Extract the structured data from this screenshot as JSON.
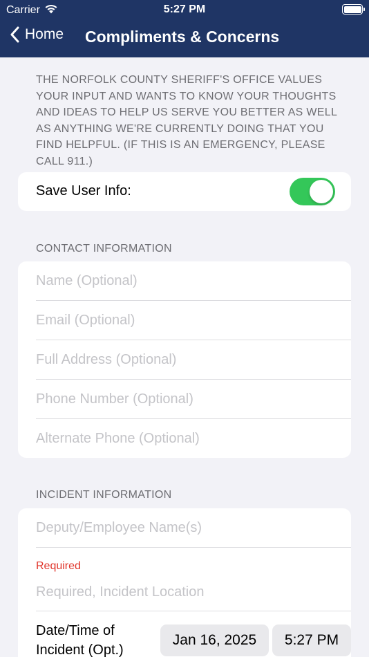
{
  "status_bar": {
    "carrier": "Carrier",
    "time": "5:27 PM",
    "wifi_icon": "wifi-icon",
    "battery_icon": "battery-icon"
  },
  "nav": {
    "back_label": "Home",
    "title": "Compliments & Concerns"
  },
  "intro_text": "THE NORFOLK COUNTY SHERIFF'S OFFICE VALUES YOUR INPUT AND WANTS TO KNOW YOUR THOUGHTS AND IDEAS TO HELP US SERVE YOU BETTER AS WELL AS ANYTHING WE'RE CURRENTLY DOING THAT YOU FIND HELPFUL. (IF THIS IS AN EMERGENCY, PLEASE CALL 911.)",
  "save_user_info": {
    "label": "Save User Info:",
    "enabled": true,
    "accent": "#34c759"
  },
  "contact": {
    "header": "CONTACT INFORMATION",
    "fields": [
      {
        "placeholder": "Name (Optional)",
        "value": ""
      },
      {
        "placeholder": "Email (Optional)",
        "value": ""
      },
      {
        "placeholder": "Full Address (Optional)",
        "value": ""
      },
      {
        "placeholder": "Phone Number (Optional)",
        "value": ""
      },
      {
        "placeholder": "Alternate Phone (Optional)",
        "value": ""
      }
    ]
  },
  "incident": {
    "header": "INCIDENT INFORMATION",
    "deputy_field": {
      "placeholder": "Deputy/Employee Name(s)",
      "value": ""
    },
    "required_label": "Required",
    "location_field": {
      "placeholder": "Required, Incident Location",
      "value": ""
    },
    "datetime_label": "Date/Time of Incident (Opt.)",
    "date_value": "Jan 16, 2025",
    "time_value": "5:27 PM"
  },
  "colors": {
    "nav_background": "#1f3565",
    "page_background": "#f2f2f7",
    "required_red": "#e0352b"
  }
}
